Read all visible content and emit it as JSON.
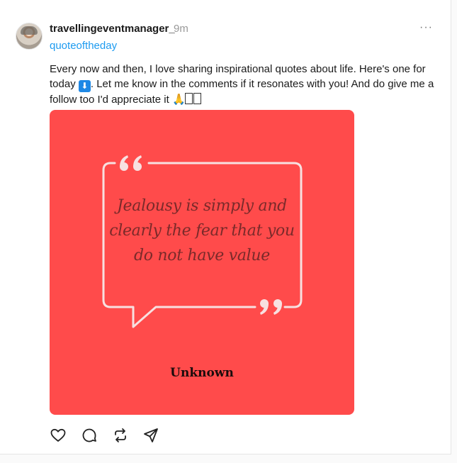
{
  "post": {
    "username": "travellingeventmanager_",
    "time": "9m",
    "more_label": "···",
    "tag": "quoteoftheday",
    "caption": {
      "part1": "Every now and then, I love sharing inspirational quotes about life. Here's one for today ",
      "arrow_emoji": "⬇",
      "part2": ". Let me know in the comments if it resonates with you! And do give me a follow too I'd appreciate it ",
      "pray_emoji": "🙏"
    },
    "image": {
      "background_color": "#ff4b4b",
      "quote_line1": "Jealousy is simply and",
      "quote_line2": "clearly the fear that you",
      "quote_line3": "do not have value",
      "author": "Unknown",
      "open_quote": "❝",
      "close_quote": "❞"
    },
    "actions": [
      "heart-icon",
      "comment-icon",
      "repost-icon",
      "share-icon"
    ]
  },
  "colors": {
    "accent": "#1d9bf0",
    "username": "#1a1a1a",
    "muted": "#999999",
    "image_bg": "#ff4b4b"
  }
}
